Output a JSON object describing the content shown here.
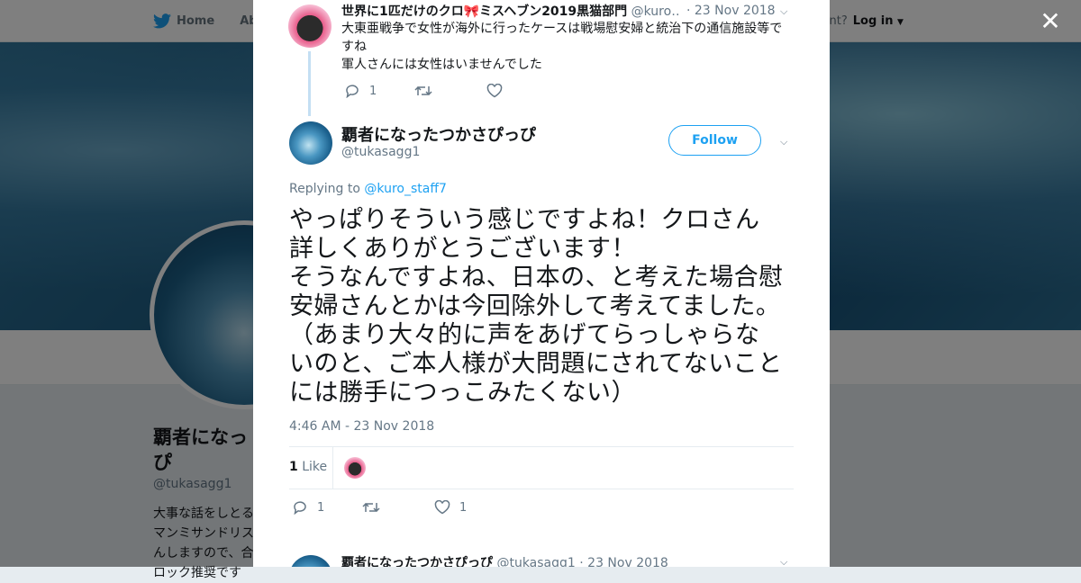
{
  "background": {
    "nav": {
      "home_label": "Home",
      "about_label": "Abo",
      "account_text": "ccount?",
      "login_label": "Log in"
    },
    "profile_name": "覇者になっ\nぴ",
    "profile_handle": "@tukasagg1",
    "bio_lines": [
      "大事な話をしとる",
      "マンミサンドリス",
      "んしますので、合",
      "ロック推奨です"
    ]
  },
  "modal": {
    "parent_tweet": {
      "name": "世界に1匹だけのクロ🎀ミスヘブン2019黒猫部門",
      "handle": "@kuro…",
      "date": "· 23 Nov 2018",
      "text_line1": "大東亜戦争で女性が海外に行ったケースは戦場慰安婦と統治下の通信施設等で",
      "text_line2": "すね",
      "text_line3": "軍人さんには女性はいませんでした",
      "reply_count": "1",
      "retweet_count": "",
      "like_count": ""
    },
    "main_tweet": {
      "name": "覇者になったつかさぴっぴ",
      "handle": "@tukasagg1",
      "follow_label": "Follow",
      "replying_prefix": "Replying to",
      "replying_mention": "@kuro_staff7",
      "text_lines": [
        "やっぱりそういう感じですよね！クロさん",
        "詳しくありがとうございます！",
        "そうなんですよね、日本の、と考えた場合慰",
        "安婦さんとかは今回除外して考えてました。",
        "（あまり大々的に声をあげてらっしゃらな",
        "いのと、ご本人様が大問題にされてないこと",
        "には勝手につっこみたくない）"
      ],
      "timestamp": "4:46 AM - 23 Nov 2018",
      "likes_number": "1",
      "likes_label": "Like",
      "reply_count": "1",
      "retweet_count": "",
      "like_count": "1"
    },
    "next_tweet": {
      "name": "覇者になったつかさぴっぴ",
      "handle": "@tukasagg1",
      "date": "· 23 Nov 2018"
    }
  },
  "colors": {
    "accent": "#1da1f2",
    "text": "#14171a",
    "muted": "#657786"
  },
  "icons": {
    "close": "close-icon",
    "twitter": "twitter-bird-icon"
  }
}
